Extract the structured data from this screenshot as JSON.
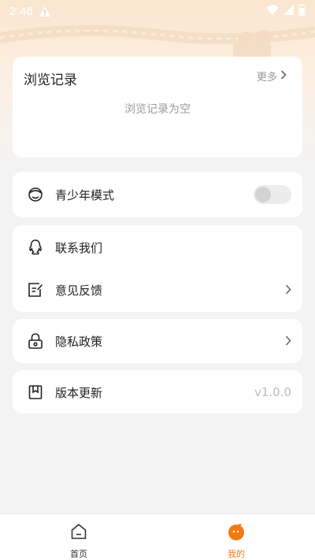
{
  "status_bar": {
    "time": "2:46"
  },
  "history": {
    "title": "浏览记录",
    "more_label": "更多",
    "empty_text": "浏览记录为空"
  },
  "settings": {
    "teen_mode": {
      "label": "青少年模式",
      "enabled": false,
      "icon": "teen-face-icon"
    },
    "contact": {
      "label": "联系我们",
      "icon": "qq-penguin-icon"
    },
    "feedback": {
      "label": "意见反馈",
      "icon": "edit-note-icon"
    },
    "privacy": {
      "label": "隐私政策",
      "icon": "lock-icon"
    },
    "update": {
      "label": "版本更新",
      "version": "v1.0.0",
      "icon": "bookmark-icon"
    }
  },
  "tabbar": {
    "home": {
      "label": "首页",
      "icon": "home-icon"
    },
    "mine": {
      "label": "我的",
      "icon": "mascot-avatar-icon",
      "active": true
    }
  },
  "colors": {
    "accent": "#f07b16",
    "background": "#f3f3f3",
    "card": "#ffffff",
    "muted_text": "#999999"
  }
}
